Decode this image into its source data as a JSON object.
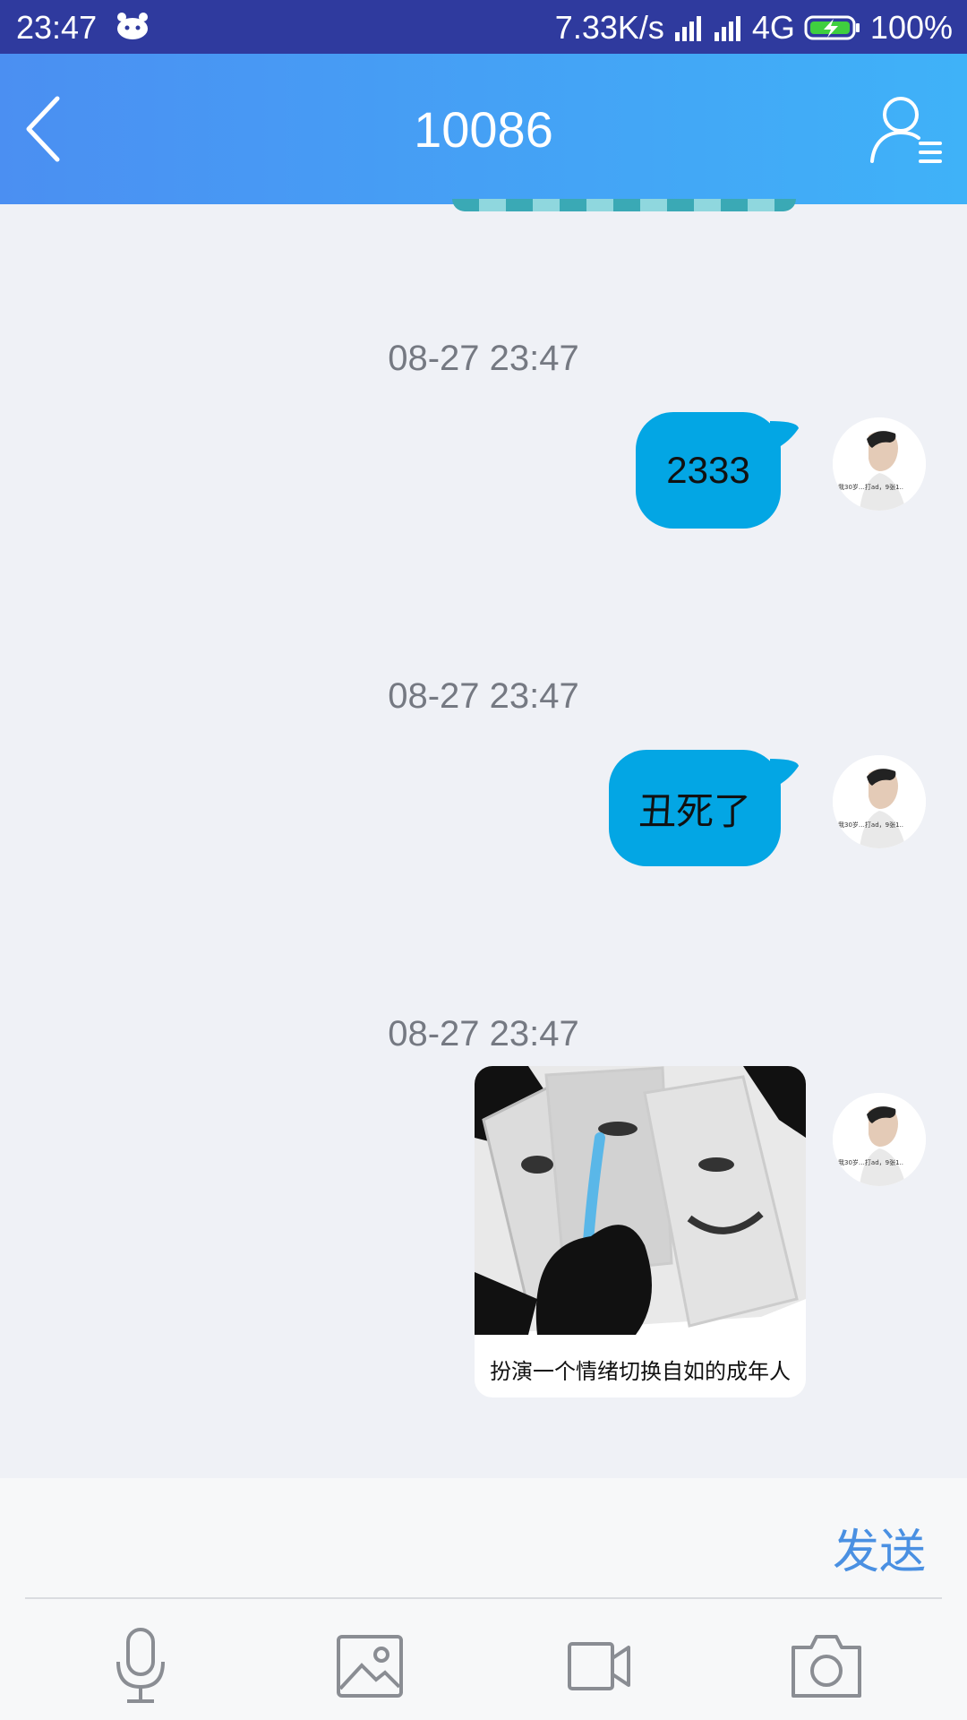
{
  "status_bar": {
    "time": "23:47",
    "network_speed": "7.33K/s",
    "network_type": "4G",
    "battery": "100%"
  },
  "header": {
    "back_icon": "chevron-left-icon",
    "title": "10086",
    "contact_icon": "contact-info-icon"
  },
  "messages": [
    {
      "time": "08-27 23:47",
      "type": "text",
      "text": "2333"
    },
    {
      "time": "08-27 23:47",
      "type": "text",
      "text": "丑死了"
    },
    {
      "time": "08-27 23:47",
      "type": "sticker",
      "caption": "扮演一个情绪切换自如的成年人"
    }
  ],
  "avatar_caption": "我30岁，在IT打ad，9张1..",
  "composer": {
    "send_label": "发送",
    "tools": [
      "microphone-icon",
      "image-icon",
      "video-icon",
      "camera-icon"
    ]
  },
  "colors": {
    "header_start": "#4b8ff2",
    "header_end": "#3fb2f8",
    "bubble": "#03a6e4",
    "send": "#4a90e2",
    "statusbar": "#2f3a9e"
  }
}
